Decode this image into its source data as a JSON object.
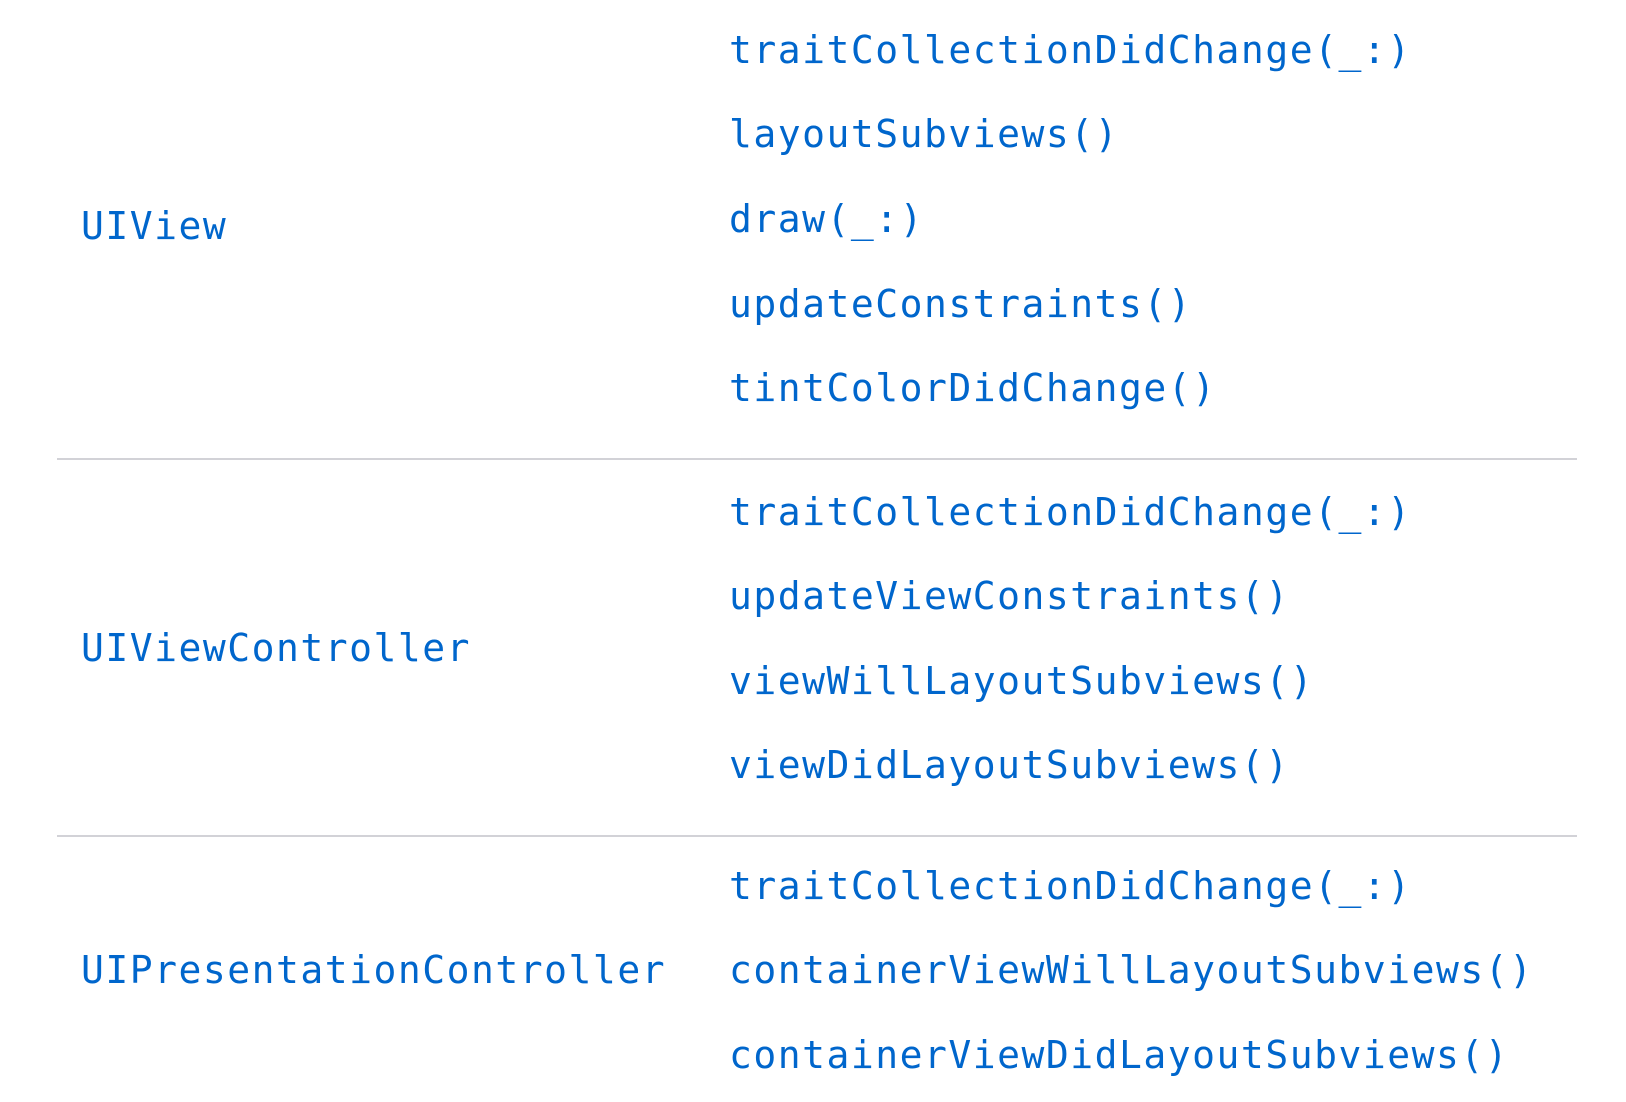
{
  "rows": [
    {
      "class_name": "UIView",
      "methods": [
        "traitCollectionDidChange(_:)",
        "layoutSubviews()",
        "draw(_:)",
        "updateConstraints()",
        "tintColorDidChange()"
      ]
    },
    {
      "class_name": "UIViewController",
      "methods": [
        "traitCollectionDidChange(_:)",
        "updateViewConstraints()",
        "viewWillLayoutSubviews()",
        "viewDidLayoutSubviews()"
      ]
    },
    {
      "class_name": "UIPresentationController",
      "methods": [
        "traitCollectionDidChange(_:)",
        "containerViewWillLayoutSubviews()",
        "containerViewDidLayoutSubviews()"
      ]
    }
  ],
  "colors": {
    "link": "#0066cc",
    "divider": "#d2d2d7",
    "background": "#ffffff"
  }
}
